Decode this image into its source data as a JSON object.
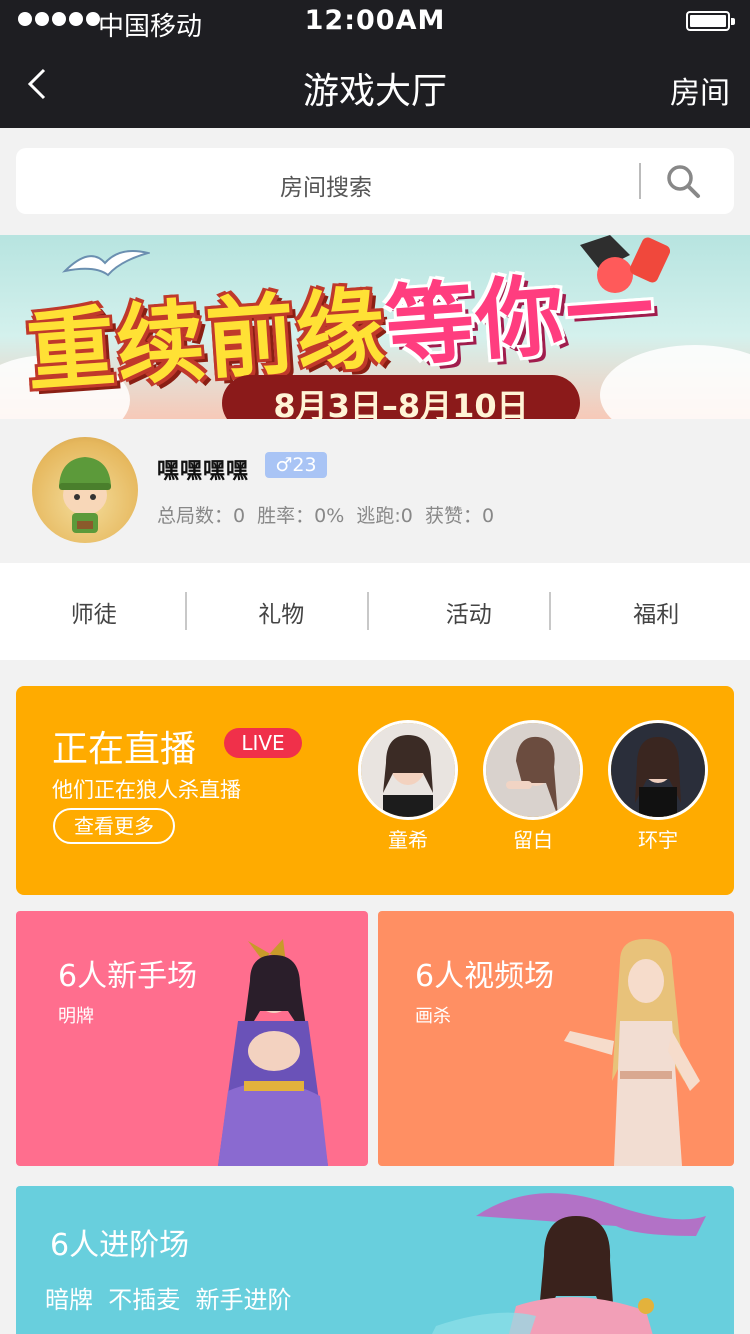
{
  "status_bar": {
    "carrier": "中国移动",
    "time": "12:00AM"
  },
  "nav": {
    "title": "游戏大厅",
    "right_label": "房间"
  },
  "search": {
    "placeholder": "房间搜索"
  },
  "banner": {
    "title_part1": "重续前缘",
    "title_part2": "等你一夏",
    "date_range": "8月3日–8月10日"
  },
  "profile": {
    "username": "嘿嘿嘿嘿",
    "gender_age": "♂23",
    "stats": "总局数：0  胜率：0%  逃跑:0  获赞：0"
  },
  "tabs": [
    {
      "label": "师徒"
    },
    {
      "label": "礼物"
    },
    {
      "label": "活动"
    },
    {
      "label": "福利"
    }
  ],
  "live": {
    "title": "正在直播",
    "badge": "LIVE",
    "subtitle": "他们正在狼人杀直播",
    "more_label": "查看更多",
    "streamers": [
      {
        "name": "童希"
      },
      {
        "name": "留白"
      },
      {
        "name": "环宇"
      }
    ]
  },
  "rooms": [
    {
      "title": "6人新手场",
      "subtitle": "明牌",
      "color": "#ff6e8e"
    },
    {
      "title": "6人视频场",
      "subtitle": "画杀",
      "color": "#ff8f63"
    },
    {
      "title": "6人进阶场",
      "subtitle": "暗牌  不插麦  新手进阶",
      "color": "#68cfdd"
    }
  ],
  "colors": {
    "nav_bg": "#1e1e22",
    "live_card": "#ffab00",
    "live_badge": "#f0304a",
    "gender_badge": "#a9c4f5"
  }
}
